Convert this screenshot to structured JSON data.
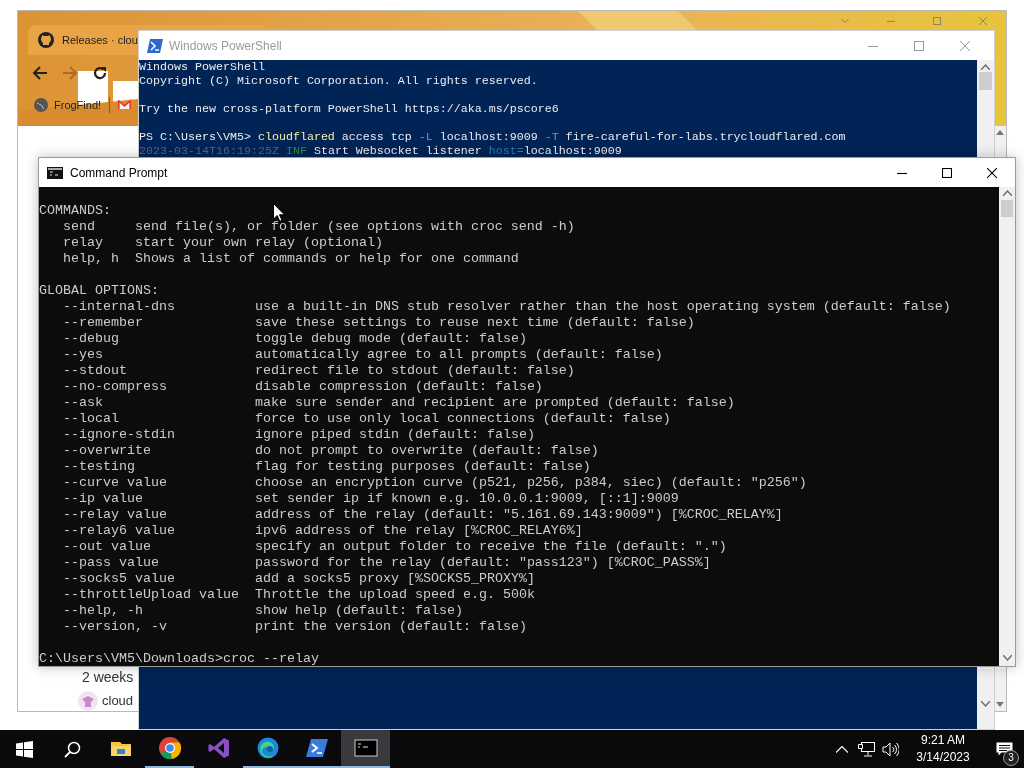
{
  "browser": {
    "tab_title": "Releases · clou",
    "bookmarks": [
      {
        "label": "FrogFind!"
      }
    ],
    "release": {
      "age": "2 weeks",
      "author": "cloud"
    }
  },
  "powershell": {
    "title": "Windows PowerShell",
    "blocks": [
      [
        [
          {
            "text": "Windows PowerShell",
            "kind": "plain"
          }
        ],
        [
          {
            "text": "Copyright (C) Microsoft Corporation. All rights reserved.",
            "kind": "plain"
          }
        ]
      ],
      [
        [
          {
            "text": "Try the new cross-platform PowerShell https://aka.ms/pscore6",
            "kind": "plain"
          }
        ]
      ],
      [
        [
          {
            "text": "PS C:\\Users\\VM5> ",
            "kind": "plain"
          },
          {
            "text": "cloudflared",
            "kind": "command"
          },
          {
            "text": " access tcp ",
            "kind": "plain"
          },
          {
            "text": "-L",
            "kind": "parameter"
          },
          {
            "text": " localhost:9009 ",
            "kind": "plain"
          },
          {
            "text": "-T",
            "kind": "parameter"
          },
          {
            "text": " fire-careful-for-labs.trycloudflared.com",
            "kind": "plain"
          }
        ],
        [
          {
            "text": "2023-03-14T16:19:25Z ",
            "kind": "timestamp"
          },
          {
            "text": "INF",
            "kind": "level"
          },
          {
            "text": " Start Websocket listener ",
            "kind": "plain"
          },
          {
            "text": "host=",
            "kind": "key"
          },
          {
            "text": "localhost:9009",
            "kind": "plain"
          }
        ]
      ]
    ]
  },
  "command_prompt": {
    "title": "Command Prompt",
    "commands_heading": "COMMANDS:",
    "commands": [
      {
        "name": "send",
        "description": "send file(s), or folder (see options with croc send -h)"
      },
      {
        "name": "relay",
        "description": "start your own relay (optional)"
      },
      {
        "name": "help, h",
        "description": "Shows a list of commands or help for one command"
      }
    ],
    "options_heading": "GLOBAL OPTIONS:",
    "options": [
      {
        "flag": "--internal-dns",
        "description": "use a built-in DNS stub resolver rather than the host operating system (default: false)"
      },
      {
        "flag": "--remember",
        "description": "save these settings to reuse next time (default: false)"
      },
      {
        "flag": "--debug",
        "description": "toggle debug mode (default: false)"
      },
      {
        "flag": "--yes",
        "description": "automatically agree to all prompts (default: false)"
      },
      {
        "flag": "--stdout",
        "description": "redirect file to stdout (default: false)"
      },
      {
        "flag": "--no-compress",
        "description": "disable compression (default: false)"
      },
      {
        "flag": "--ask",
        "description": "make sure sender and recipient are prompted (default: false)"
      },
      {
        "flag": "--local",
        "description": "force to use only local connections (default: false)"
      },
      {
        "flag": "--ignore-stdin",
        "description": "ignore piped stdin (default: false)"
      },
      {
        "flag": "--overwrite",
        "description": "do not prompt to overwrite (default: false)"
      },
      {
        "flag": "--testing",
        "description": "flag for testing purposes (default: false)"
      },
      {
        "flag": "--curve value",
        "description": "choose an encryption curve (p521, p256, p384, siec) (default: \"p256\")"
      },
      {
        "flag": "--ip value",
        "description": "set sender ip if known e.g. 10.0.0.1:9009, [::1]:9009"
      },
      {
        "flag": "--relay value",
        "description": "address of the relay (default: \"5.161.69.143:9009\") [%CROC_RELAY%]"
      },
      {
        "flag": "--relay6 value",
        "description": "ipv6 address of the relay [%CROC_RELAY6%]"
      },
      {
        "flag": "--out value",
        "description": "specify an output folder to receive the file (default: \".\")"
      },
      {
        "flag": "--pass value",
        "description": "password for the relay (default: \"pass123\") [%CROC_PASS%]"
      },
      {
        "flag": "--socks5 value",
        "description": "add a socks5 proxy [%SOCKS5_PROXY%]"
      },
      {
        "flag": "--throttleUpload value",
        "description": "Throttle the upload speed e.g. 500k"
      },
      {
        "flag": "--help, -h",
        "description": "show help (default: false)"
      },
      {
        "flag": "--version, -v",
        "description": "print the version (default: false)"
      }
    ],
    "prompt": "C:\\Users\\VM5\\Downloads>croc --relay"
  },
  "taskbar": {
    "apps": [
      {
        "kind": "explorer",
        "running": false,
        "selected": false
      },
      {
        "kind": "chrome",
        "running": true,
        "selected": false
      },
      {
        "kind": "visual-studio",
        "running": false,
        "selected": false
      },
      {
        "kind": "edge",
        "running": true,
        "selected": false
      },
      {
        "kind": "powershell",
        "running": true,
        "selected": false
      },
      {
        "kind": "terminal",
        "running": true,
        "selected": true
      }
    ],
    "clock": {
      "time": "9:21 AM",
      "date": "3/14/2023"
    },
    "notifications": {
      "count": "3"
    }
  }
}
